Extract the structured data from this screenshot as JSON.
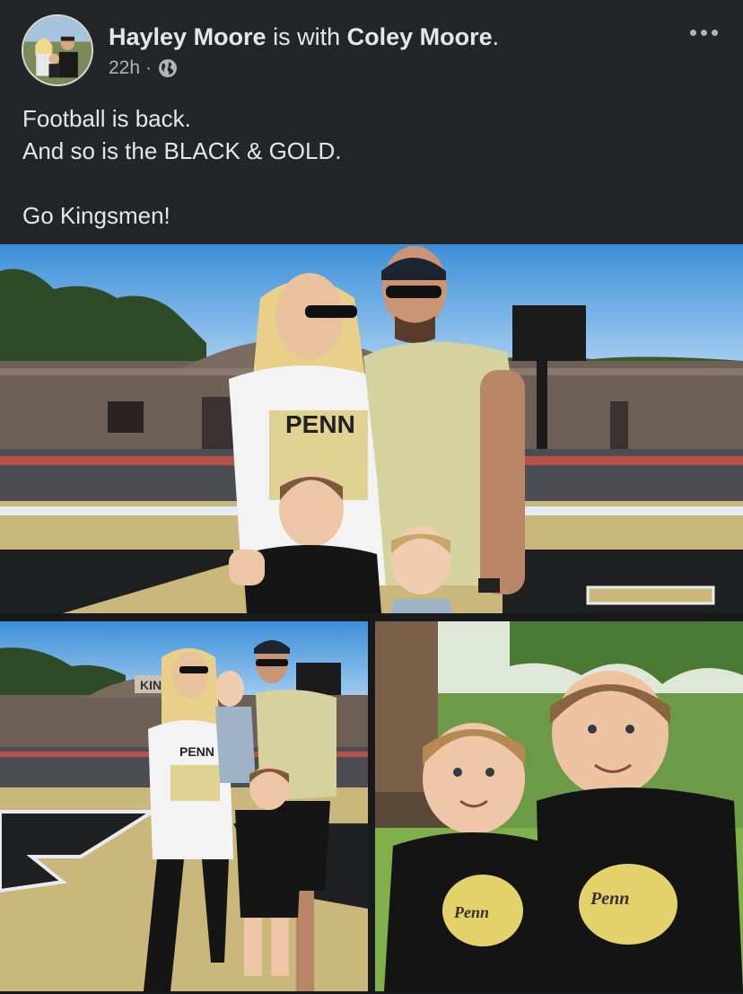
{
  "post": {
    "author": "Hayley Moore",
    "with_text": "is with",
    "tagged": "Coley Moore",
    "period": ".",
    "time": "22h",
    "separator": "·",
    "audience_icon": "globe-icon",
    "more_icon": "more-options-icon",
    "text_lines": [
      "Football is back.",
      "And so is the BLACK & GOLD.",
      "",
      "Go Kingsmen!"
    ]
  },
  "photos": {
    "main": {
      "description_icon": "family-photo",
      "shirt_text": "PENN",
      "shirt_sub": "Penn"
    },
    "left": {
      "sign_text": "KINGS",
      "shirt_text": "PENN"
    },
    "right": {
      "shirt_left": "Penn",
      "shirt_right": "Penn"
    }
  },
  "colors": {
    "background": "#242526",
    "text_primary": "#e4e6eb",
    "text_secondary": "#b0b3b8",
    "gold": "#c8b96a",
    "black": "#1a1a1a"
  }
}
